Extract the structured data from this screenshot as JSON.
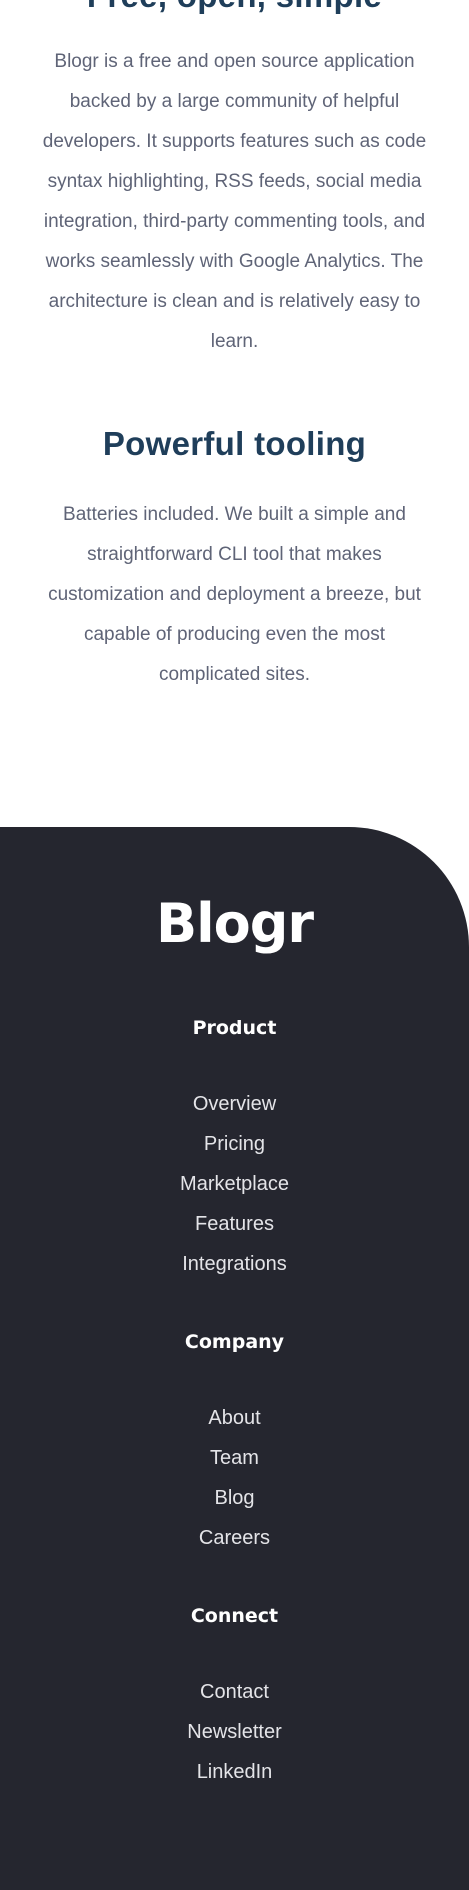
{
  "sections": {
    "free_open_simple": {
      "title": "Free, open, simple",
      "body": "Blogr is a free and open source application backed by a large community of helpful developers. It supports features such as code syntax highlighting, RSS feeds, social media integration, third-party commenting tools, and works seamlessly with Google Analytics. The architecture is clean and is relatively easy to learn."
    },
    "powerful_tooling": {
      "title": "Powerful tooling",
      "body": "Batteries included. We built a simple and straightforward CLI tool that makes customization and deployment a breeze, but capable of producing even the most complicated sites."
    }
  },
  "footer": {
    "logo": "Blogr",
    "columns": [
      {
        "heading": "Product",
        "links": [
          "Overview",
          "Pricing",
          "Marketplace",
          "Features",
          "Integrations"
        ]
      },
      {
        "heading": "Company",
        "links": [
          "About",
          "Team",
          "Blog",
          "Careers"
        ]
      },
      {
        "heading": "Connect",
        "links": [
          "Contact",
          "Newsletter",
          "LinkedIn"
        ]
      }
    ]
  },
  "colors": {
    "heading": "#1f3e5a",
    "body_text": "#5f6477",
    "footer_bg": "#25262f",
    "footer_text": "#ffffff"
  }
}
